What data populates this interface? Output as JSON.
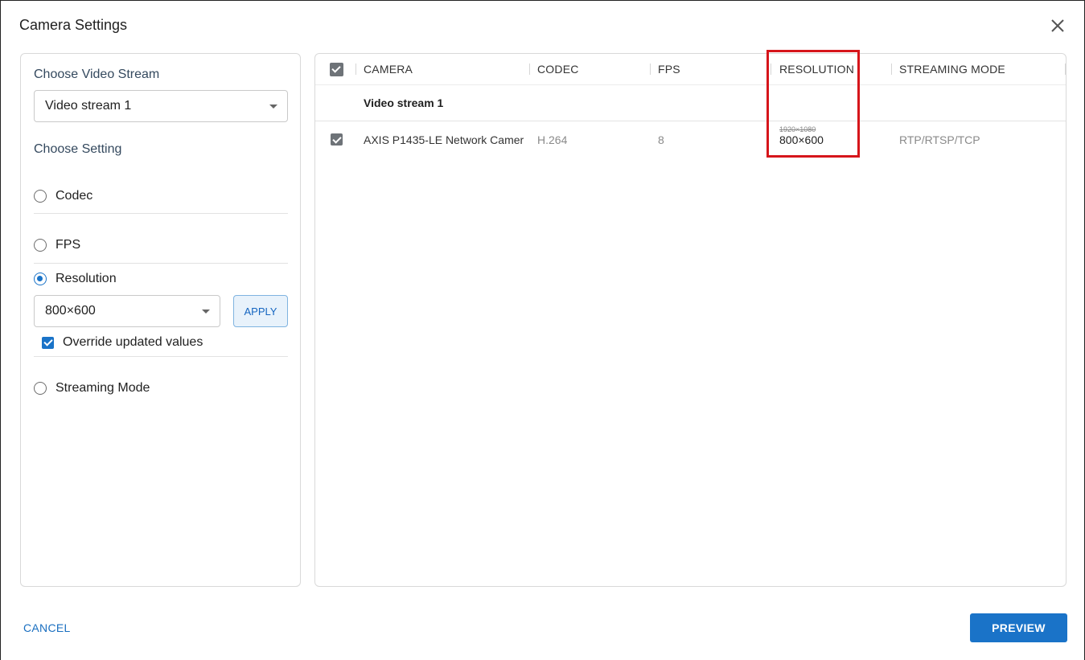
{
  "dialog": {
    "title": "Camera Settings"
  },
  "left_panel": {
    "stream_label": "Choose Video Stream",
    "stream_value": "Video stream 1",
    "setting_label": "Choose Setting",
    "options": [
      {
        "label": "Codec",
        "checked": false
      },
      {
        "label": "FPS",
        "checked": false
      },
      {
        "label": "Resolution",
        "checked": true
      },
      {
        "label": "Streaming Mode",
        "checked": false
      }
    ],
    "resolution_value": "800×600",
    "apply_label": "APPLY",
    "override_label": "Override updated values",
    "override_checked": true
  },
  "table": {
    "columns": [
      "CAMERA",
      "CODEC",
      "FPS",
      "RESOLUTION",
      "STREAMING MODE"
    ],
    "group_label": "Video stream 1",
    "rows": [
      {
        "checked": true,
        "camera": "AXIS P1435-LE Network Camer",
        "codec": "H.264",
        "fps": "8",
        "resolution_old": "1920×1080",
        "resolution_new": "800×600",
        "streaming_mode": "RTP/RTSP/TCP"
      }
    ]
  },
  "footer": {
    "cancel_label": "CANCEL",
    "preview_label": "PREVIEW"
  },
  "colors": {
    "accent": "#1a73c8",
    "highlight": "#d6151b"
  }
}
